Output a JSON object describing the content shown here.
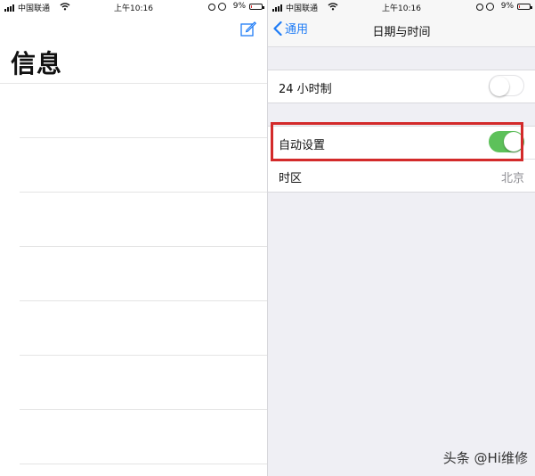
{
  "left_panel": {
    "status_bar": {
      "carrier": "中国联通",
      "time": "上午10:16",
      "battery_pct": "9%",
      "battery_level": 0.09
    },
    "title": "信息",
    "message_rows": 7
  },
  "right_panel": {
    "status_bar": {
      "carrier": "中国联通",
      "time": "上午10:16",
      "battery_pct": "9%",
      "battery_level": 0.09
    },
    "nav": {
      "back_label": "通用",
      "title": "日期与时间"
    },
    "settings": {
      "hour24": {
        "label": "24 小时制",
        "on": false
      },
      "auto_set": {
        "label": "自动设置",
        "on": true
      },
      "timezone": {
        "label": "时区",
        "value": "北京"
      }
    }
  },
  "watermark": "头条 @Hi维修",
  "colors": {
    "accent": "#1f7cf6",
    "switch_on": "#5dc15a",
    "highlight": "#d32a2a",
    "battery_low": "#e03030"
  }
}
